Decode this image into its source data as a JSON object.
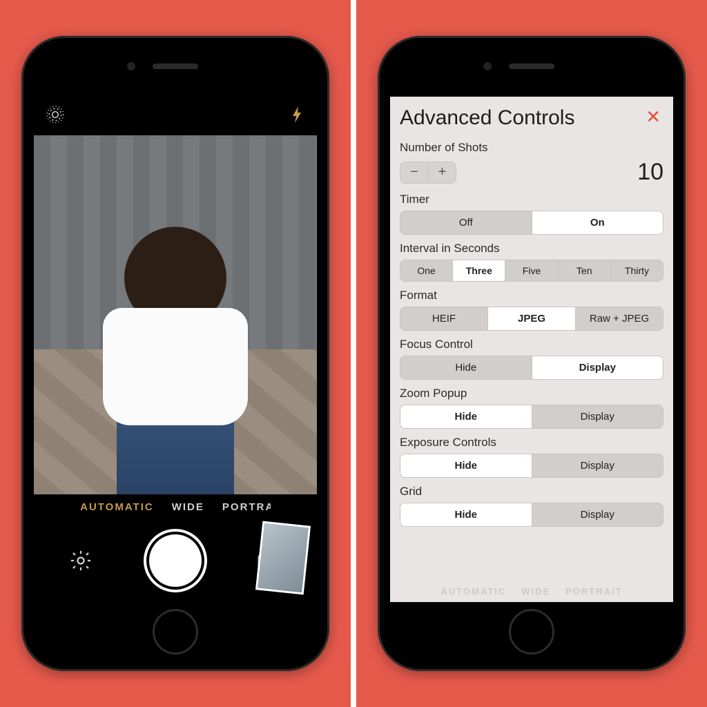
{
  "camera": {
    "modes": [
      "AUTOMATIC",
      "WIDE",
      "PORTRAIT"
    ],
    "selected_mode_index": 0
  },
  "panel": {
    "title": "Advanced Controls",
    "shots": {
      "label": "Number of Shots",
      "value": "10"
    },
    "timer": {
      "label": "Timer",
      "options": [
        "Off",
        "On"
      ],
      "selected": 1
    },
    "interval": {
      "label": "Interval in Seconds",
      "options": [
        "One",
        "Three",
        "Five",
        "Ten",
        "Thirty"
      ],
      "selected": 1
    },
    "format": {
      "label": "Format",
      "options": [
        "HEIF",
        "JPEG",
        "Raw + JPEG"
      ],
      "selected": 1
    },
    "focus": {
      "label": "Focus Control",
      "options": [
        "Hide",
        "Display"
      ],
      "selected": 1
    },
    "zoom": {
      "label": "Zoom Popup",
      "options": [
        "Hide",
        "Display"
      ],
      "selected": 0
    },
    "exposure": {
      "label": "Exposure Controls",
      "options": [
        "Hide",
        "Display"
      ],
      "selected": 0
    },
    "grid": {
      "label": "Grid",
      "options": [
        "Hide",
        "Display"
      ],
      "selected": 0
    },
    "ghost_modes": [
      "AUTOMATIC",
      "WIDE",
      "PORTRAIT"
    ]
  }
}
